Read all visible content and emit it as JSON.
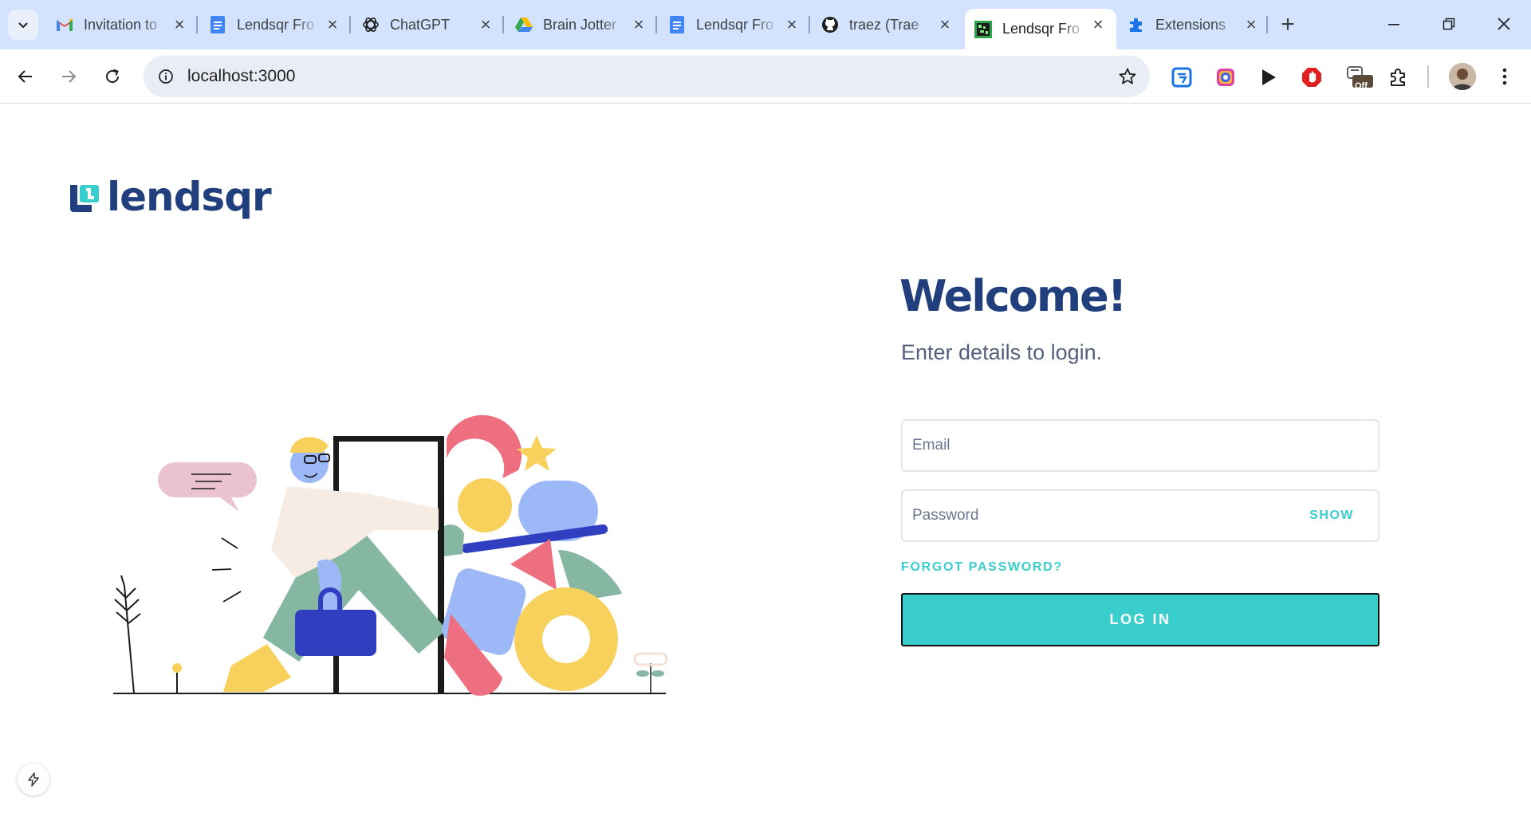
{
  "browser": {
    "tabs": [
      {
        "title": "Invitation to",
        "icon": "gmail-icon"
      },
      {
        "title": "Lendsqr Fro",
        "icon": "docs-icon"
      },
      {
        "title": "ChatGPT",
        "icon": "chatgpt-icon"
      },
      {
        "title": "Brain Jotter",
        "icon": "drive-icon"
      },
      {
        "title": "Lendsqr Fro",
        "icon": "docs-icon"
      },
      {
        "title": "traez (Trae",
        "icon": "github-icon"
      },
      {
        "title": "Lendsqr Fro",
        "icon": "lendsqr-favicon-icon",
        "active": true
      },
      {
        "title": "Extensions",
        "icon": "puzzle-icon"
      }
    ],
    "url": "localhost:3000",
    "extension_badge": "Off"
  },
  "page": {
    "logo_text": "lendsqr",
    "heading": "Welcome!",
    "subheading": "Enter details to login.",
    "email_placeholder": "Email",
    "password_placeholder": "Password",
    "show_label": "SHOW",
    "forgot_label": "FORGOT PASSWORD?",
    "login_label": "LOG IN"
  },
  "colors": {
    "brand_navy": "#213f7d",
    "brand_teal": "#39cdcc",
    "muted_text": "#545f7d"
  }
}
